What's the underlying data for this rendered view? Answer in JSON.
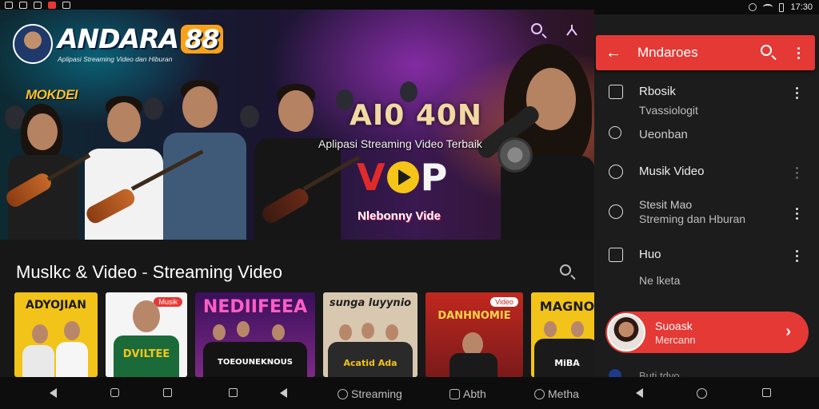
{
  "app": {
    "brand_name": "ANDARA",
    "brand_number": "88",
    "brand_subtitle": "Aplipasi Streaming Video dan Hiburan"
  },
  "hero": {
    "tag_yellow": "MOKDEI",
    "big_code": "AI0 40N",
    "tagline": "Aplipasi Streaming Video Terbaik",
    "logo_v": "V",
    "logo_p": "P",
    "logo_sub": "Nlebonny Vide"
  },
  "section": {
    "title_main": "Muslkc & Video",
    "title_dash": " - ",
    "title_sub": "Streaming Video"
  },
  "thumbnails": [
    {
      "title": "ADYOJIAN",
      "bg": "#f2c318",
      "text_color": "#1b1b1b"
    },
    {
      "title": "DVILTEE",
      "badge": "Musik",
      "bg": "#f5f5f5",
      "text_color": "#1b7a2f"
    },
    {
      "title": "NEDIIFEEA",
      "sub": "TOEOUNEKNOUS",
      "bg": "#5b1e6e",
      "text_color": "#ff5ec4"
    },
    {
      "title": "sunga luyynio",
      "sub": "Acatid Ada",
      "bg": "#d8c8b0",
      "text_color": "#222"
    },
    {
      "title": "DANHNOMIE",
      "badge": "Video",
      "bg": "#c0281f",
      "text_color": "#ffd54a"
    },
    {
      "title": "MAGNO",
      "sub": "MiBA",
      "bg": "#f2c318",
      "text_color": "#1b1b1b"
    }
  ],
  "bottom_nav_left": {
    "tabs": [
      {
        "label": "Streaming",
        "icon": "heart-icon"
      },
      {
        "label": "Abth",
        "icon": "square-icon"
      },
      {
        "label": "Metha",
        "icon": "search-icon"
      }
    ]
  },
  "status_right": {
    "time": "17:30"
  },
  "drawer": {
    "title": "Mndaroes",
    "items": [
      {
        "label": "Rbosik",
        "icon": "bookmark-icon"
      },
      {
        "label": "Tvassiologit",
        "icon": "",
        "sub": true
      },
      {
        "label": "Ueonban",
        "icon": "search-icon"
      },
      {
        "label": "Musik Video",
        "icon": "music-icon"
      },
      {
        "label": "Stesit Mao",
        "sub_line": "Streming dan Hburan",
        "icon": "location-icon"
      },
      {
        "label": "Huo",
        "icon": "share-icon"
      },
      {
        "label": "Ne lketa",
        "icon": "",
        "sub": true
      }
    ],
    "pill": {
      "line1": "Suoask",
      "line2": "Mercann"
    },
    "peek_text": "Buti tdyo"
  },
  "colors": {
    "accent": "#e53935",
    "brand_badge": "#f7a21a",
    "background": "#171717"
  }
}
